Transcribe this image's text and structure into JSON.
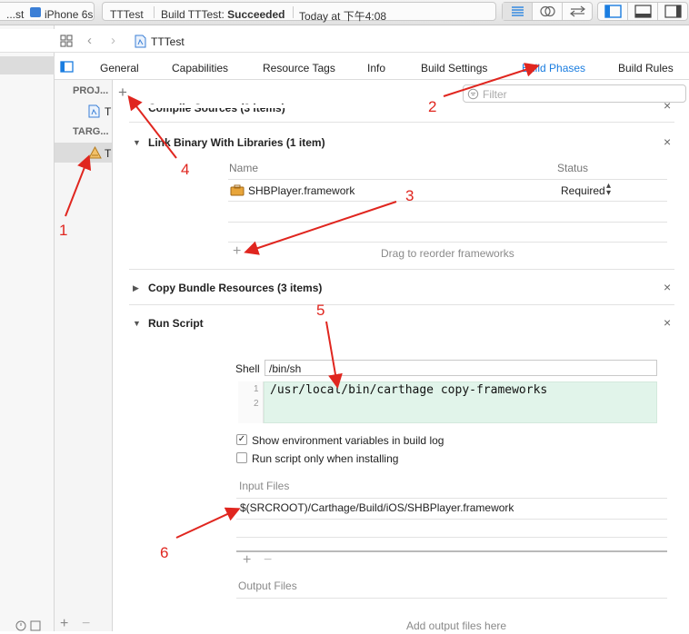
{
  "toolbar": {
    "scheme": "...st",
    "device": "iPhone 6s",
    "project": "TTTest",
    "build_prefix": "Build TTTest: ",
    "build_status": "Succeeded",
    "build_time": "Today at 下午4:08"
  },
  "jumpbar": {
    "file_name": "TTTest"
  },
  "tabs": [
    {
      "label": "General"
    },
    {
      "label": "Capabilities"
    },
    {
      "label": "Resource Tags"
    },
    {
      "label": "Info"
    },
    {
      "label": "Build Settings"
    },
    {
      "label": "Build Phases",
      "active": true
    },
    {
      "label": "Build Rules"
    }
  ],
  "filter": {
    "placeholder": "Filter"
  },
  "sidebar": {
    "project_header": "PROJ...",
    "project_item": "T",
    "targets_header": "TARG...",
    "target_item": "T"
  },
  "phases": {
    "compile": {
      "title": "Compile Sources (3 items)"
    },
    "link": {
      "title": "Link Binary With Libraries (1 item)",
      "col_name": "Name",
      "col_status": "Status",
      "rows": [
        {
          "name": "SHBPlayer.framework",
          "status": "Required"
        }
      ],
      "drag_hint": "Drag to reorder frameworks"
    },
    "copy": {
      "title": "Copy Bundle Resources (3 items)"
    },
    "run_script": {
      "title": "Run Script",
      "shell_label": "Shell",
      "shell_value": "/bin/sh",
      "script_lines": [
        "/usr/local/bin/carthage copy-frameworks",
        ""
      ],
      "line_numbers": [
        "1",
        "2"
      ],
      "opt_show_env": "Show environment variables in build log",
      "opt_show_env_checked": true,
      "opt_only_installing": "Run script only when installing",
      "opt_only_installing_checked": false,
      "input_files_label": "Input Files",
      "input_files": [
        "$(SRCROOT)/Carthage/Build/iOS/SHBPlayer.framework"
      ],
      "output_files_label": "Output Files",
      "output_hint": "Add output files here"
    }
  },
  "annotations": [
    "1",
    "2",
    "3",
    "4",
    "5",
    "6"
  ],
  "colors": {
    "accent": "#1a7de0",
    "annotation": "#e0261f",
    "script_bg": "#e1f4ea"
  }
}
